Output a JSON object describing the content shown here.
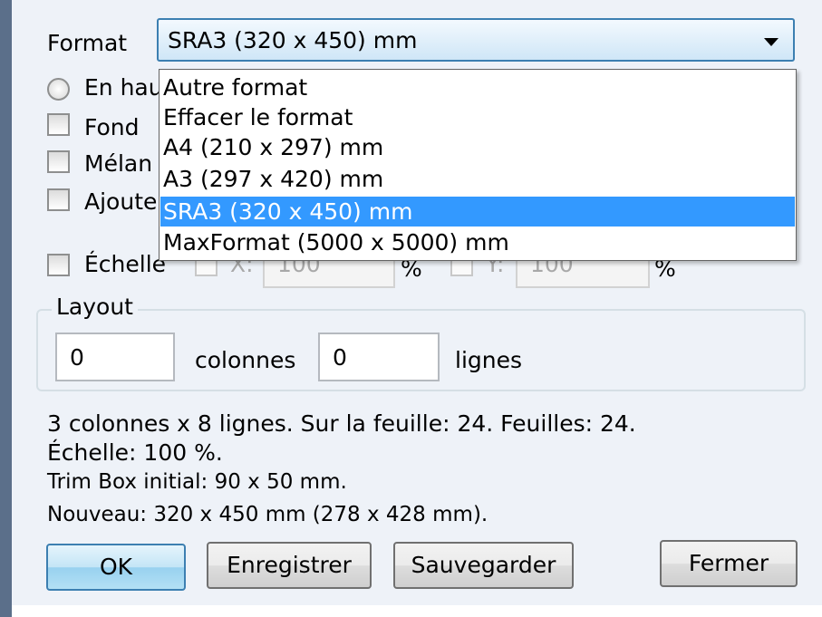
{
  "format": {
    "label": "Format",
    "selected": "SRA3 (320 x 450) mm",
    "options": [
      "Autre format",
      "Effacer le format",
      "A4 (210 x 297) mm",
      "A3 (297 x 420) mm",
      "SRA3 (320 x 450) mm",
      "MaxFormat (5000 x 5000) mm"
    ],
    "selected_index": 4
  },
  "options": {
    "radio_label": "En hau",
    "fond_label": "Fond",
    "melange_label": "Mélan",
    "ajouter_label": "Ajoute"
  },
  "scale": {
    "label": "Échelle",
    "x_label": "X:",
    "x_value": "100",
    "y_label": "Y:",
    "y_value": "100",
    "percent": "%"
  },
  "layout": {
    "title": "Layout",
    "columns_value": "0",
    "columns_label": "colonnes",
    "rows_value": "0",
    "rows_label": "lignes"
  },
  "info": {
    "line1": "3 colonnes x 8 lignes. Sur la feuille: 24. Feuilles: 24.",
    "line2": "Échelle: 100 %.",
    "line3": "Trim Box initial: 90 x 50 mm.",
    "line4": "Nouveau: 320 x 450 mm (278 x 428 mm)."
  },
  "buttons": {
    "ok": "OK",
    "enregistrer": "Enregistrer",
    "sauvegarder": "Sauvegarder",
    "fermer": "Fermer"
  },
  "colors": {
    "selection": "#3399ff",
    "dialog_bg": "#eef2f8",
    "focus_border": "#3c7fb1"
  }
}
